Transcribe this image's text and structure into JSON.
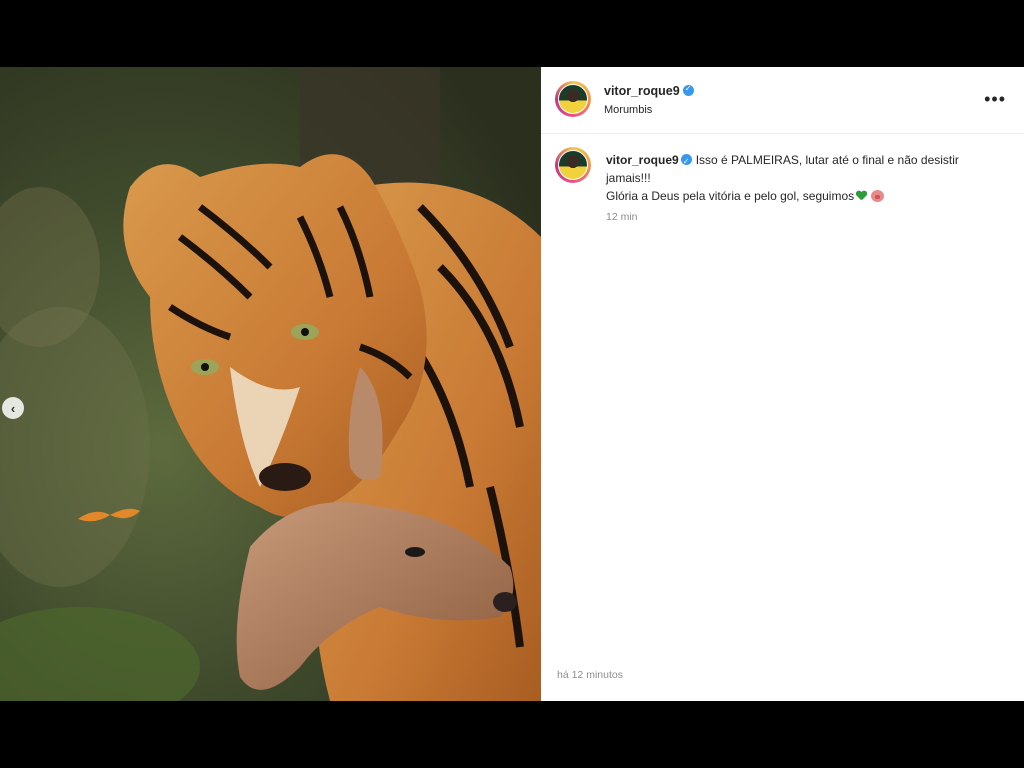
{
  "post": {
    "username": "vitor_roque9",
    "location": "Morumbis",
    "caption_line1": "Isso é PALMEIRAS, lutar até o final e não desistir jamais!!!",
    "caption_line2": "Glória a Deus pela vitória e pelo gol, seguimos",
    "comment_time": "12 min",
    "post_time": "há 12 minutos"
  },
  "icons": {
    "verified": "verified-badge-icon",
    "more": "more-options-icon",
    "prev": "chevron-left-icon",
    "emoji1": "green-heart-emoji",
    "emoji2": "pig-face-emoji"
  },
  "colors": {
    "verified": "#3897f0",
    "background": "#000000",
    "panel": "#ffffff"
  }
}
